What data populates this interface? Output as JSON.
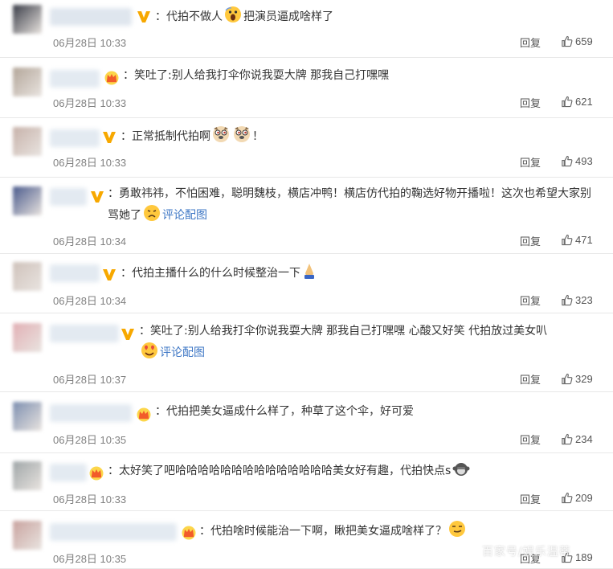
{
  "comments": [
    {
      "badge": "v",
      "text_parts": [
        {
          "t": "代拍不做人"
        },
        {
          "e": "scream"
        },
        {
          "t": "把演员逼成啥样了"
        }
      ],
      "time": "06月28日 10:33",
      "reply": "回复",
      "likes": "659"
    },
    {
      "badge": "crown",
      "text_parts": [
        {
          "t": "笑吐了:别人给我打伞你说我耍大牌 那我自己打嘿嘿"
        }
      ],
      "time": "06月28日 10:33",
      "reply": "回复",
      "likes": "621"
    },
    {
      "badge": "v",
      "text_parts": [
        {
          "t": "正常抵制代拍啊"
        },
        {
          "e": "doge"
        },
        {
          "e": "doge"
        },
        {
          "t": "！"
        }
      ],
      "time": "06月28日 10:33",
      "reply": "回复",
      "likes": "493"
    },
    {
      "badge": "v",
      "text_parts": [
        {
          "t": "勇敢祎祎，不怕困难，聪明魏枝，横店冲鸭！横店仿代拍的鞠选好物开播啦！这次也希望大家别骂她了"
        },
        {
          "e": "sad"
        },
        {
          "link": "评论配图"
        }
      ],
      "time": "06月28日 10:34",
      "reply": "回复",
      "likes": "471"
    },
    {
      "badge": "v",
      "text_parts": [
        {
          "t": "代拍主播什么的什么时候整治一下"
        },
        {
          "e": "pray"
        }
      ],
      "time": "06月28日 10:34",
      "reply": "回复",
      "likes": "323"
    },
    {
      "badge": "v",
      "text_parts": [
        {
          "t": "笑吐了:别人给我打伞你说我耍大牌 那我自己打嘿嘿 心酸又好笑 代拍放过美女叭"
        },
        {
          "e": "love"
        },
        {
          "link": "评论配图"
        }
      ],
      "time": "06月28日 10:37",
      "reply": "回复",
      "likes": "329"
    },
    {
      "badge": "crown",
      "text_parts": [
        {
          "t": "代拍把美女逼成什么样了，种草了这个伞，好可爱"
        }
      ],
      "time": "06月28日 10:35",
      "reply": "回复",
      "likes": "234"
    },
    {
      "badge": "crown",
      "text_parts": [
        {
          "t": "太好笑了吧哈哈哈哈哈哈哈哈哈哈哈哈哈哈美女好有趣，代拍快点s"
        },
        {
          "e": "monkey"
        }
      ],
      "time": "06月28日 10:33",
      "reply": "回复",
      "likes": "209"
    },
    {
      "badge": "crown",
      "text_parts": [
        {
          "t": "代拍啥时候能治一下啊，瞅把美女逼成啥样了？"
        },
        {
          "e": "smirk"
        }
      ],
      "time": "06月28日 10:35",
      "reply": "回复",
      "likes": "189"
    }
  ],
  "watermark": "百家号/娱乐温蒂",
  "colors": {
    "link": "#3e77c5",
    "verified_badge": "#f7a800",
    "crown": "#f25c2a",
    "timestamp": "#808080",
    "text": "#333333"
  }
}
